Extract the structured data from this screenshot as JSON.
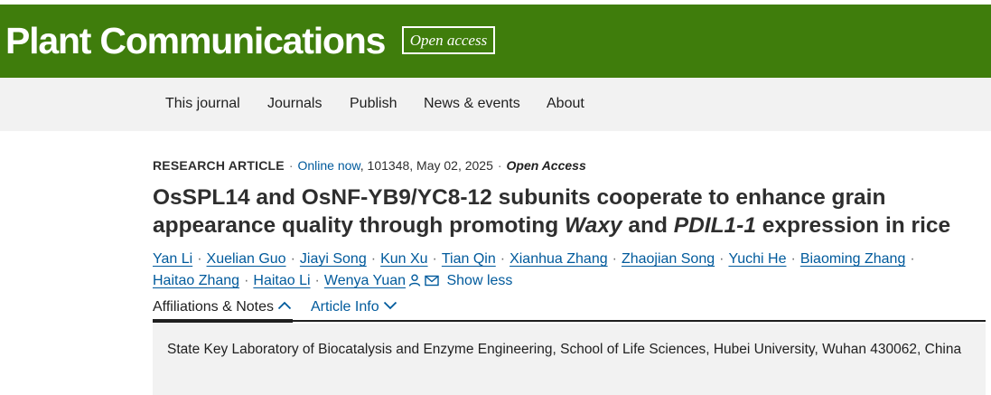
{
  "brand": {
    "logo_text": "Plant Communications",
    "open_access_badge": "Open access",
    "bar_color": "#3f7d0c"
  },
  "nav": {
    "items": [
      {
        "label": "This journal"
      },
      {
        "label": "Journals"
      },
      {
        "label": "Publish"
      },
      {
        "label": "News & events"
      },
      {
        "label": "About"
      }
    ]
  },
  "article": {
    "type": "RESEARCH ARTICLE",
    "online_status": "Online now",
    "citation": ", 101348, May 02, 2025",
    "access": "Open Access",
    "title_part1": "OsSPL14 and OsNF-YB9/YC8-12 subunits cooperate to enhance grain appearance quality through promoting ",
    "title_gene1": "Waxy",
    "title_part2": " and ",
    "title_gene2": "PDIL1-1",
    "title_part3": " expression in rice"
  },
  "authors": [
    "Yan Li",
    "Xuelian Guo",
    "Jiayi Song",
    "Kun Xu",
    "Tian Qin",
    "Xianhua Zhang",
    "Zhaojian Song",
    "Yuchi He",
    "Biaoming Zhang",
    "Haitao Zhang",
    "Haitao Li",
    "Wenya Yuan"
  ],
  "author_controls": {
    "show_less": "Show less",
    "corresponding_icons": [
      "person-icon",
      "envelope-icon"
    ]
  },
  "tabs": [
    {
      "label": "Affiliations & Notes",
      "active": true,
      "icon": "chevron-up-icon"
    },
    {
      "label": "Article Info",
      "active": false,
      "icon": "chevron-down-icon"
    }
  ],
  "affiliation": {
    "text": "State Key Laboratory of Biocatalysis and Enzyme Engineering, School of Life Sciences, Hubei University, Wuhan 430062, China"
  },
  "colors": {
    "link": "#005a9c",
    "nav_background": "#f2f2f2"
  }
}
